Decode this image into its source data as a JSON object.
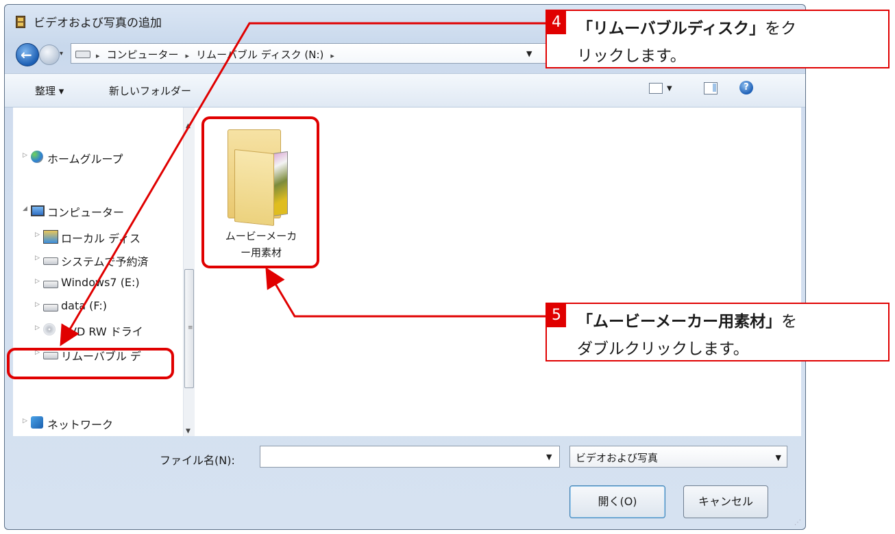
{
  "window": {
    "title": "ビデオおよび写真の追加"
  },
  "address_bar": {
    "crumbs": [
      "コンピューター",
      "リムーバブル ディスク (N:)"
    ]
  },
  "toolbar": {
    "organize_label": "整理 ▾",
    "new_folder_label": "新しいフォルダー"
  },
  "nav_pane": {
    "items": [
      {
        "label": "ホームグループ",
        "icon": "homegroup-icon"
      },
      {
        "label": "コンピューター",
        "icon": "computer-icon"
      },
      {
        "label": "ローカル ディス",
        "icon": "local-disk-icon"
      },
      {
        "label": "システムで予約済",
        "icon": "drive-icon"
      },
      {
        "label": "Windows7 (E:)",
        "icon": "drive-icon"
      },
      {
        "label": "data (F:)",
        "icon": "drive-icon"
      },
      {
        "label": "DVD RW ドライ",
        "icon": "dvd-icon"
      },
      {
        "label": "リムーバブル デ",
        "icon": "removable-drive-icon"
      },
      {
        "label": "ネットワーク",
        "icon": "network-icon"
      }
    ]
  },
  "files": [
    {
      "name": "ムービーメーカー用素材",
      "line1": "ムービーメーカ",
      "line2": "ー用素材",
      "icon": "folder-icon"
    }
  ],
  "bottom": {
    "filename_label": "ファイル名(N):",
    "filename_value": "",
    "filetype_value": "ビデオおよび写真",
    "open_label": "開く(O)",
    "cancel_label": "キャンセル"
  },
  "annotations": [
    {
      "number": "4",
      "bold": "「リムーバブルディスク」",
      "rest1": "をク",
      "line2": "リックします。"
    },
    {
      "number": "5",
      "bold": "「ムービーメーカー用素材」",
      "rest1": "を",
      "line2": "ダブルクリックします。"
    }
  ],
  "colors": {
    "annotation_red": "#e00000",
    "window_frame": "#c8d8ec",
    "folder": "#ecd27e"
  }
}
